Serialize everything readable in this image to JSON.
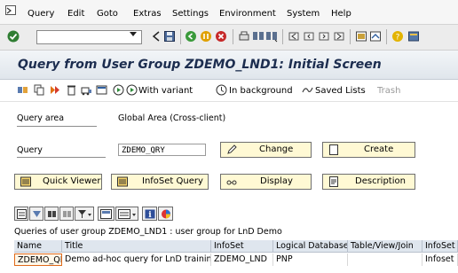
{
  "menu": {
    "items": [
      {
        "id": "query",
        "label": "Query"
      },
      {
        "id": "edit",
        "label": "Edit"
      },
      {
        "id": "goto",
        "label": "Goto"
      },
      {
        "id": "extras",
        "label": "Extras"
      },
      {
        "id": "settings",
        "label": "Settings"
      },
      {
        "id": "environment",
        "label": "Environment"
      },
      {
        "id": "system",
        "label": "System"
      },
      {
        "id": "help",
        "label": "Help"
      }
    ]
  },
  "command_field": {
    "value": ""
  },
  "title": "Query from User Group ZDEMO_LND1: Initial Screen",
  "app_toolbar": {
    "with_variant": "With variant",
    "in_background": "In background",
    "saved_lists": "Saved Lists",
    "trash": "Trash"
  },
  "form": {
    "query_area_label": "Query area",
    "query_area_value": "Global Area (Cross-client)",
    "query_label": "Query",
    "query_value": "ZDEMO_QRY"
  },
  "buttons": {
    "change": "Change",
    "create": "Create",
    "quick_viewer": "Quick Viewer",
    "infoset_query": "InfoSet Query",
    "display": "Display",
    "description": "Description"
  },
  "grid": {
    "title": "Queries of user group ZDEMO_LND1 : user group for LnD Demo",
    "columns": [
      "Name",
      "Title",
      "InfoSet",
      "Logical Database",
      "Table/View/Join",
      "InfoSet"
    ],
    "rows": [
      [
        "ZDEMO_QRY",
        "Demo ad-hoc query for LnD training",
        "ZDEMO_LND",
        "PNP",
        "",
        "Infoset"
      ]
    ]
  },
  "colors": {
    "title_text": "#1c2d4f",
    "button_bg": "#fff9d4",
    "selected_cell_border": "#e06a1a",
    "grid_header_bg": "#dfe6ee"
  }
}
